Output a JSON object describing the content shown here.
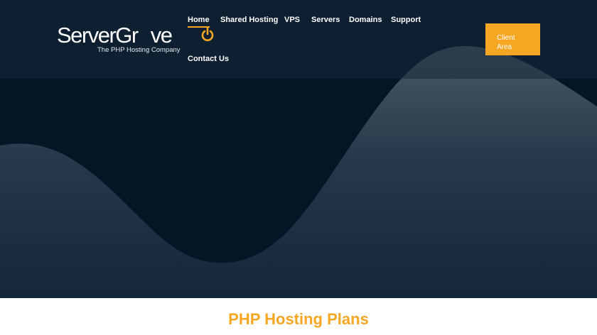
{
  "logo": {
    "name": "ServerGr",
    "name_suffix": "ve",
    "tagline": "The PHP Hosting Company"
  },
  "nav": {
    "items": [
      {
        "label": "Home",
        "active": true
      },
      {
        "label": "Shared Hosting"
      },
      {
        "label": "VPS"
      },
      {
        "label": "Servers"
      },
      {
        "label": "Domains"
      },
      {
        "label": "Support"
      },
      {
        "label": "Contact Us"
      }
    ]
  },
  "cta": {
    "line1": "Client",
    "line2": "Area"
  },
  "main": {
    "heading": "PHP Hosting Plans"
  },
  "colors": {
    "accent": "#f5a623",
    "hero_bg": "#041526",
    "wave": "#3a4b5b",
    "header_overlay": "#16283a"
  }
}
